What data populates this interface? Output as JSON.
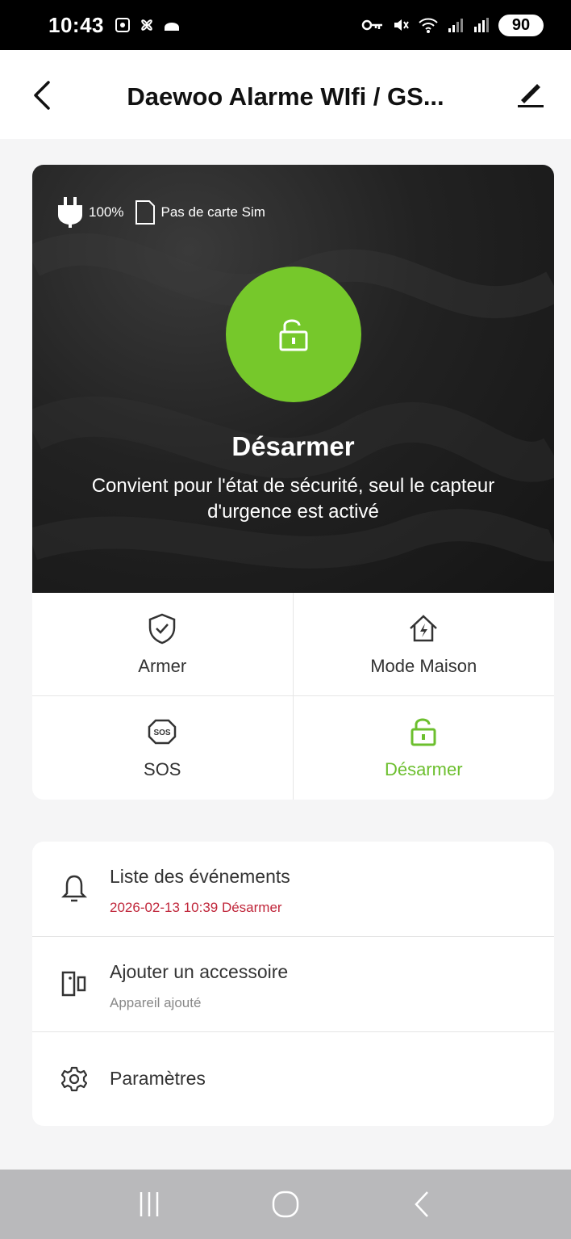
{
  "status_bar": {
    "time": "10:43",
    "battery": "90"
  },
  "header": {
    "title": "Daewoo Alarme WIfi / GS..."
  },
  "hero": {
    "power_level": "100%",
    "sim_status": "Pas de carte Sim",
    "mode_title": "Désarmer",
    "mode_description": "Convient pour l'état de sécurité, seul le capteur d'urgence est activé",
    "accent_color": "#76c82b"
  },
  "modes": [
    {
      "label": "Armer",
      "icon": "shield-check-icon",
      "active": false
    },
    {
      "label": "Mode Maison",
      "icon": "home-bolt-icon",
      "active": false
    },
    {
      "label": "SOS",
      "icon": "sos-icon",
      "active": false
    },
    {
      "label": "Désarmer",
      "icon": "unlock-icon",
      "active": true
    }
  ],
  "list": {
    "events_title": "Liste des événements",
    "events_last": "2026-02-13 10:39 Désarmer",
    "accessory_title": "Ajouter un accessoire",
    "accessory_sub": "Appareil ajouté",
    "settings_title": "Paramètres"
  },
  "colors": {
    "active_green": "#6cbf2e",
    "event_red": "#c0263a"
  }
}
